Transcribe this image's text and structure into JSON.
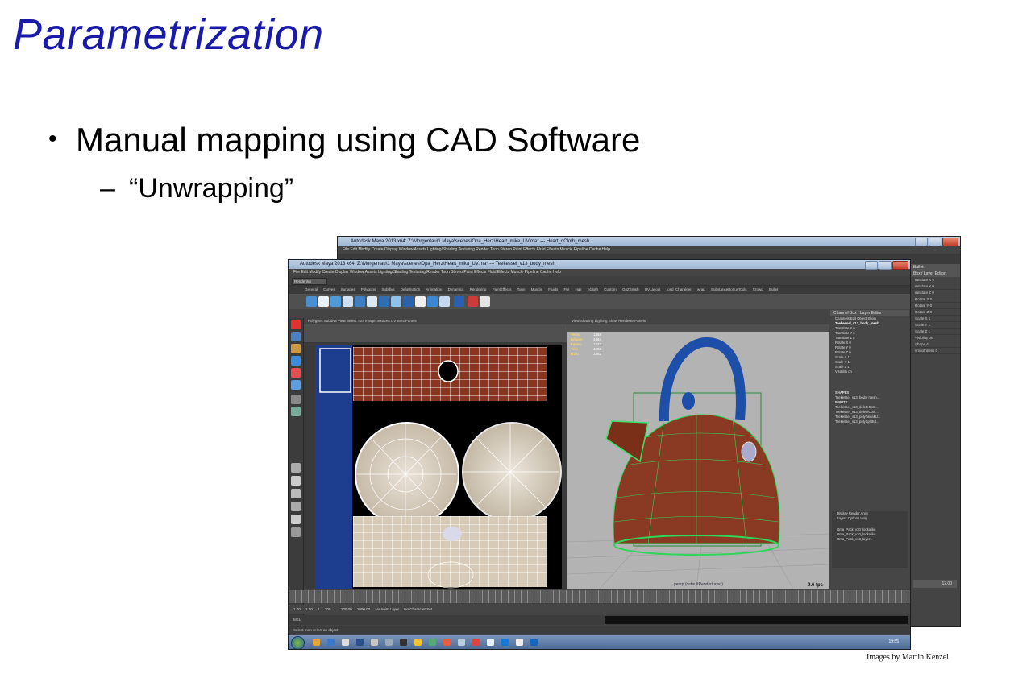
{
  "slide": {
    "title": "Parametrization",
    "bullet_1": "Manual mapping using CAD Software",
    "bullet_1_marker": "•",
    "bullet_2": "“Unwrapping”",
    "bullet_2_marker": "–",
    "credit": "Images by Martin Kenzel"
  },
  "maya_back": {
    "title": "Autodesk Maya 2013 x64: Z:\\Morgentau\\1 Maya\\scenes\\Opa_Herz\\Heart_mika_UV.ma* --- Heart_nCloth_mesh",
    "menus": "File   Edit   Modify   Create   Display   Window   Assets   Lighting/Shading   Texturing   Render   Toon   Stereo   Paint Effects   Fluid Effects   Muscle   Pipeline Cache   Help",
    "side_header": "Bullet",
    "channel_header": "Box / Layer Editor",
    "channels": [
      "ranslate X 0",
      "ranslate Y 0",
      "ranslate Z 0",
      "Rotate X 0",
      "Rotate Y 0",
      "Rotate Z 0",
      "Scale X 1",
      "Scale Y 1",
      "Scale Z 1",
      "Visibility on",
      "Shape 4",
      "smoothness 0"
    ],
    "time": "12.00"
  },
  "maya_front": {
    "title": "Autodesk Maya 2013 x64: Z:\\Morgentau\\1 Maya\\scenes\\Opa_Herz\\Heart_mika_UV.ma* --- Teekessel_v13_body_mesh",
    "menus": "File   Edit   Modify   Create   Display   Window   Assets   Lighting/Shading   Texturing   Render   Toon   Stereo   Paint Effects   Fluid Effects   Muscle   Pipeline Cache   Help",
    "mode": "Rendering",
    "shelf_tabs": "General  Curves  Surfaces  Polygons  Subdivs  Deformation  Animation  Dynamics  Rendering  PaintEffects  Toon  Muscle  Fluids  Fur  Hair  nCloth  Custom  GoZBrush  UVLayout  rosd_Charakter  wrap  SubstanceBonusTools  Crowd  Bullet",
    "uv_editor_menu": "Polygons  Subdivs  View  Select  Tool  Image  Textures  UV Sets  Panels",
    "viewport_menu": "View  Shading  Lighting  Show  Renderer  Panels",
    "hud": [
      {
        "label": "Verts:",
        "value": "1368"
      },
      {
        "label": "Edges:",
        "value": "4464"
      },
      {
        "label": "Faces:",
        "value": "1323"
      },
      {
        "label": "Tris:",
        "value": "4092"
      },
      {
        "label": "UVs:",
        "value": "1862"
      }
    ],
    "camera_label": "persp (defaultRenderLayer)",
    "fps": "9.6 fps",
    "channel_box_title": "Channel Box / Layer Editor",
    "channel_tabs": "Channels  Edit  Object  Show",
    "object_name": "Teekessel_v13_body_mesh",
    "channels": [
      "Translate X 0",
      "Translate Y 0",
      "Translate Z 0",
      "Rotate X 0",
      "Rotate Y 0",
      "Rotate Z 0",
      "Scale X 1",
      "Scale Y 1",
      "Scale Z 1",
      "Visibility on"
    ],
    "shapes_label": "SHAPES",
    "shape_item": "Teekessel_v13_body_mesh...",
    "inputs_label": "INPUTS",
    "inputs": [
      "Teekessel_v13_deleteCom...",
      "Teekessel_v13_deleteCom...",
      "Teekessel_v13_polyTweakU...",
      "Teekessel_v13_polySplitEd..."
    ],
    "layer_tabs": "Display  Render  Anim",
    "layer_menu": "Layers  Options  Help",
    "layers": [
      "Oma_Pack_v30_lookalike",
      "Oma_Pack_v30_lookalike",
      "Oma_Pack_v13_layer1"
    ],
    "range_start": "1.00",
    "range_current": "1.00",
    "range_marker": "1",
    "range_mid": "100",
    "range_end": "100.00",
    "range_max": "1000.00",
    "anim_layer": "No Anim Layer",
    "char_set": "No Character Set",
    "mel_label": "MEL",
    "help_text": "Select from select an object",
    "clock": "19:55"
  }
}
